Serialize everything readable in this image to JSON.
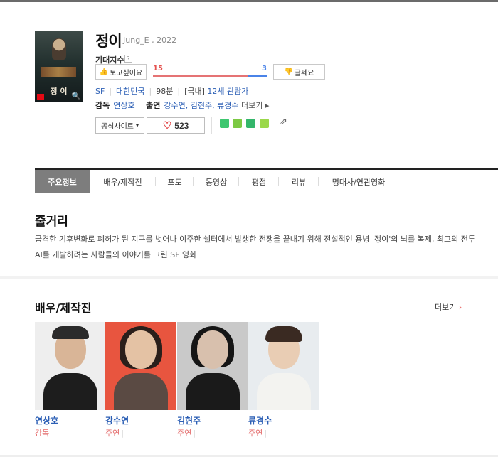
{
  "movie": {
    "title": "정이",
    "subtitle": "Jung_E , 2022",
    "poster_title": "정 이"
  },
  "expectation": {
    "label": "기대지수",
    "help": "?",
    "want_label": "보고싶어요",
    "no_label": "글쎄요",
    "want_count": "15",
    "no_count": "3",
    "want_ratio": 0.833
  },
  "meta": {
    "genre": "SF",
    "country": "대한민국",
    "runtime": "98분",
    "rating_prefix": "[국내]",
    "rating": "12세 관람가"
  },
  "crew": {
    "director_label": "감독",
    "director": "연상호",
    "cast_label": "출연",
    "cast": "강수연, 김현주, 류경수",
    "more": "더보기"
  },
  "actions": {
    "site_label": "공식사이트",
    "likes": "523"
  },
  "share_colors": [
    "#3ec76f",
    "#7cc943",
    "#34b66b",
    "#9bd84a"
  ],
  "tabs": [
    {
      "label": "주요정보"
    },
    {
      "label": "배우/제작진"
    },
    {
      "label": "포토"
    },
    {
      "label": "동영상"
    },
    {
      "label": "평점"
    },
    {
      "label": "리뷰"
    },
    {
      "label": "명대사/연관영화"
    }
  ],
  "plot": {
    "heading": "줄거리",
    "text": "급격한 기후변화로 폐허가 된 지구를 벗어나 이주한 쉘터에서 발생한 전쟁을 끝내기 위해 전설적인 용병 '정이'의 뇌를 복제, 최고의 전투 AI를 개발하려는 사람들의 이야기를 그린 SF 영화"
  },
  "cast_section": {
    "heading": "배우/제작진",
    "more": "더보기",
    "people": [
      {
        "name": "연상호",
        "role": "감독"
      },
      {
        "name": "강수연",
        "role": "주연"
      },
      {
        "name": "김현주",
        "role": "주연"
      },
      {
        "name": "류경수",
        "role": "주연"
      }
    ]
  }
}
